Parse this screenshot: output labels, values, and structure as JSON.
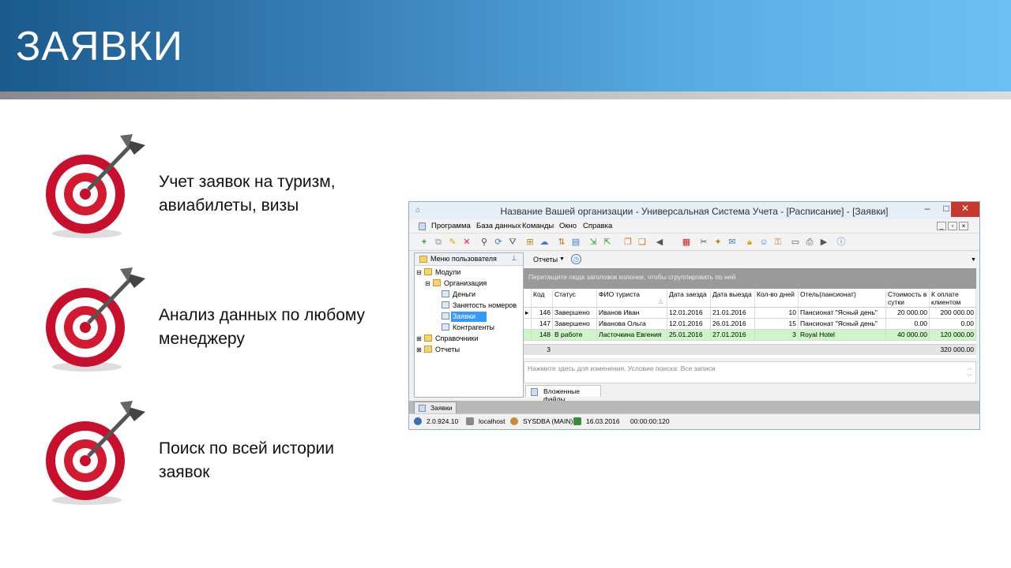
{
  "slide": {
    "title": "ЗАЯВКИ",
    "bullets": [
      {
        "text": "Учет заявок на туризм,\nавиабилеты, визы"
      },
      {
        "text": "Анализ данных по любому\nменеджеру"
      },
      {
        "text": "Поиск по всей истории\nзаявок"
      }
    ]
  },
  "window": {
    "title": "Название Вашей организации - Универсальная Система Учета - [Расписание] - [Заявки]",
    "controls": {
      "minimize": "–",
      "maximize": "□",
      "close": "✕"
    },
    "menu": [
      "Программа",
      "База данных",
      "Команды",
      "Окно",
      "Справка"
    ],
    "left_panel": {
      "header": "Меню пользователя",
      "tree": [
        "Модули",
        "Организация",
        "Деньги",
        "Занятость номеров",
        "Заявки",
        "Контрагенты",
        "Справочники",
        "Отчеты"
      ]
    },
    "reports_button": "Отчеты",
    "group_hint": "Перетащите сюда заголовок колонки, чтобы сгруппировать по ней",
    "grid": {
      "columns": [
        "Код",
        "Статус",
        "ФИО туриста",
        "Дата заезда",
        "Дата выезда",
        "Кол-во дней",
        "Отель(пансионат)",
        "Стоимость в сутки",
        "К оплате клиентом"
      ],
      "rows": [
        [
          "146",
          "Завершено",
          "Иванов Иван",
          "12.01.2016",
          "21.01.2016",
          "10",
          "Пансионат \"Ясный день\"",
          "20 000.00",
          "200 000.00"
        ],
        [
          "147",
          "Завершено",
          "Иванова Ольга",
          "12.01.2016",
          "26.01.2016",
          "15",
          "Пансионат \"Ясный день\"",
          "0.00",
          "0.00"
        ],
        [
          "148",
          "В работе",
          "Ласточкина Евгения",
          "25.01.2016",
          "27.01.2016",
          "3",
          "Royal Hotel",
          "40 000.00",
          "120 000.00"
        ]
      ],
      "footer_count": "3",
      "footer_total": "320 000.00"
    },
    "filter_text": "Нажмите здесь для изменения. Условие поиска: Все записи",
    "attached_tab": "Вложенные файлы",
    "doc_tab": "Заявки",
    "status": {
      "version": "2.0.924.10",
      "host": "localhost",
      "user": "SYSDBA (MAIN)",
      "date": "16.03.2016",
      "time": "00:00:00:120"
    },
    "colors": {
      "highlight_row": "#cdf5c8",
      "selection": "#3399ff"
    }
  }
}
